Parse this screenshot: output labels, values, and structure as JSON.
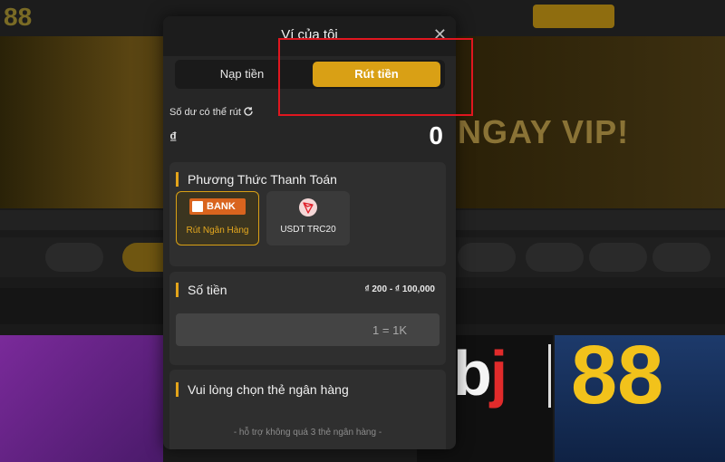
{
  "background": {
    "logo": "88",
    "hero_text": "NGAY VIP!",
    "brand_mark_left": "b",
    "brand_mark_j": "j",
    "brand_mark_right": "88"
  },
  "modal": {
    "title": "Ví của tôi",
    "close_icon": "close-icon",
    "tabs": [
      {
        "label": "Nạp tiền",
        "active": false
      },
      {
        "label": "Rút tiền",
        "active": true
      }
    ],
    "balance": {
      "label": "Số dư có thể rút",
      "currency": "₫",
      "amount": "0"
    },
    "payment": {
      "title": "Phương Thức Thanh Toán",
      "methods": [
        {
          "logo_text": "BANK",
          "label": "Rút Ngân Hàng",
          "selected": true
        },
        {
          "icon": "tron-icon",
          "label": "USDT TRC20",
          "selected": false
        }
      ]
    },
    "amount": {
      "title": "Số tiền",
      "range": "₫ 200 - ₫ 100,000",
      "placeholder": "1 = 1K"
    },
    "bank_card": {
      "title": "Vui lòng chọn thẻ ngân hàng",
      "note": "- hỗ trợ không quá 3 thẻ ngân hàng -"
    }
  },
  "colors": {
    "accent": "#d9a015",
    "panel": "#2f2f2f",
    "highlight": "#e0161f"
  }
}
